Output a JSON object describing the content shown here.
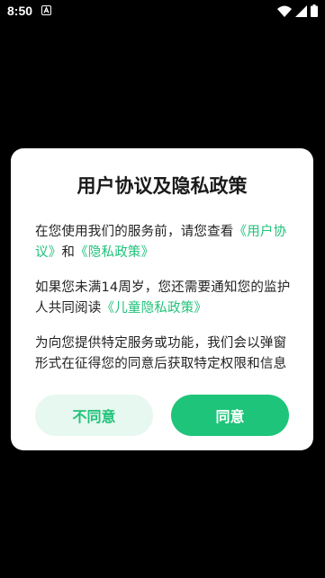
{
  "status_bar": {
    "time": "8:50",
    "icons": [
      "a-notification-icon",
      "wifi-icon",
      "signal-icon",
      "battery-icon"
    ]
  },
  "dialog": {
    "title": "用户协议及隐私政策",
    "paragraph1": {
      "prefix": "在您使用我们的服务前，请您查看",
      "link1": "《用户协议》",
      "middle": "和",
      "link2": "《隐私政策》"
    },
    "paragraph2": {
      "prefix": "如果您未满14周岁，您还需要通知您的监护人共同阅读",
      "link": "《儿童隐私政策》"
    },
    "paragraph3": {
      "text": "为向您提供特定服务或功能，我们会以弹窗形式在征得您的同意后获取特定权限和信息"
    },
    "buttons": {
      "disagree": "不同意",
      "agree": "同意"
    }
  },
  "colors": {
    "background": "#000000",
    "dialog_background": "#ffffff",
    "accent": "#1ec479",
    "accent_light": "#e6f8ef",
    "text": "#222222"
  }
}
